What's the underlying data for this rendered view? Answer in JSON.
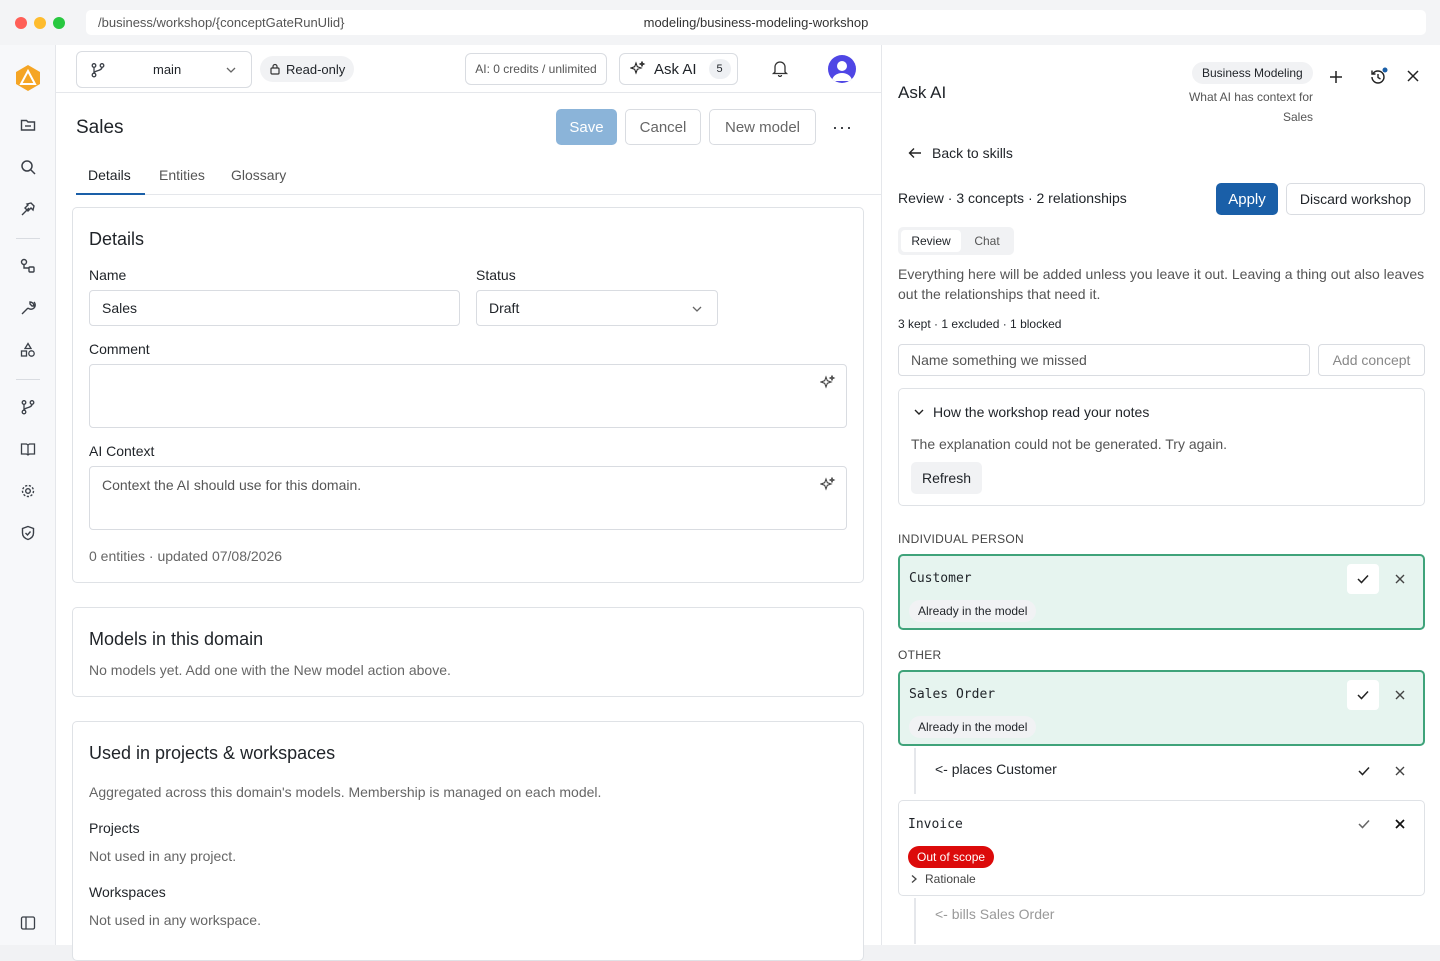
{
  "browser": {
    "url_path": "/business/workshop/{conceptGateRunUlid}",
    "url_title": "modeling/business-modeling-workshop"
  },
  "rail": {
    "icons": [
      "app-logo",
      "folder-icon",
      "search-icon",
      "hammer-icon",
      "nodes-icon",
      "wrench-icon",
      "shapes-icon",
      "branch-icon",
      "book-icon",
      "gear-icon",
      "shield-icon",
      "sidebar-toggle-icon"
    ]
  },
  "topbar": {
    "branch": "main",
    "readonly": "Read-only",
    "credits": "AI: 0 credits / unlimited",
    "ask_ai": "Ask AI",
    "ask_ai_count": "5"
  },
  "page": {
    "title": "Sales",
    "save": "Save",
    "cancel": "Cancel",
    "new_model": "New model",
    "more": "···",
    "tabs": [
      "Details",
      "Entities",
      "Glossary"
    ]
  },
  "details": {
    "heading": "Details",
    "name_label": "Name",
    "name_value": "Sales",
    "status_label": "Status",
    "status_value": "Draft",
    "comment_label": "Comment",
    "comment_value": "",
    "ai_context_label": "AI Context",
    "ai_context_placeholder": "Context the AI should use for this domain.",
    "meta": "0 entities · updated 07/08/2026"
  },
  "models": {
    "heading": "Models in this domain",
    "empty": "No models yet. Add one with the New model action above."
  },
  "usage": {
    "heading": "Used in projects & workspaces",
    "description": "Aggregated across this domain's models. Membership is managed on each model.",
    "projects_label": "Projects",
    "projects_value": "Not used in any project.",
    "workspaces_label": "Workspaces",
    "workspaces_value": "Not used in any workspace."
  },
  "panel": {
    "title": "Ask AI",
    "context_chip": "Business Modeling",
    "context_text": "What AI has context for Sales",
    "back": "Back to skills",
    "review_summary": "Review · 3 concepts · 2 relationships",
    "apply": "Apply",
    "discard": "Discard workshop",
    "seg_review": "Review",
    "seg_chat": "Chat",
    "explanation": "Everything here will be added unless you leave it out. Leaving a thing out also leaves out the relationships that need it.",
    "counts": "3 kept · 1 excluded · 1 blocked",
    "missed_placeholder": "Name something we missed",
    "add_concept": "Add concept",
    "notes_heading": "How the workshop read your notes",
    "notes_error": "The explanation could not be generated. Try again.",
    "refresh": "Refresh",
    "section_person": "INDIVIDUAL PERSON",
    "section_other": "OTHER",
    "concepts": [
      {
        "name": "Customer",
        "tag": "Already in the model"
      },
      {
        "name": "Sales Order",
        "tag": "Already in the model"
      },
      {
        "name": "Invoice",
        "tag": "Out of scope",
        "rationale": "Rationale"
      }
    ],
    "relationships": [
      "<- places Customer",
      "<- bills Sales Order"
    ]
  },
  "colors": {
    "accent": "#1a5fa8",
    "kept_bg": "#e6f4ef",
    "kept_border": "#3fa37a",
    "danger": "#dc0a0a",
    "logo": "#f5a524"
  }
}
